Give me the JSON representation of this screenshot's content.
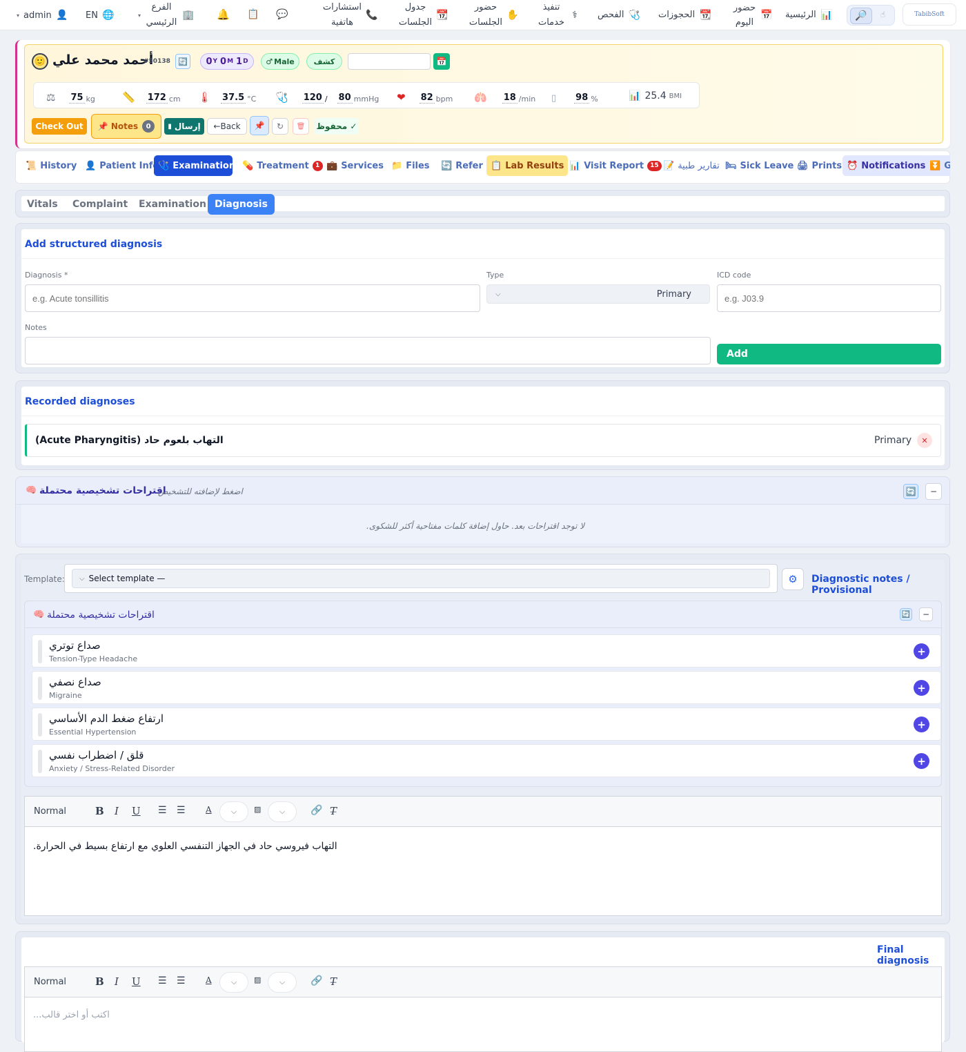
{
  "topbar": {
    "logo": "TabibSoft",
    "user": "admin",
    "lang": "EN",
    "nav": [
      {
        "label": "الرئيسية",
        "icon": "chart-icon"
      },
      {
        "label": "حضور اليوم",
        "icon": "calendar-icon"
      },
      {
        "label": "الحجوزات",
        "icon": "calendar-31-icon"
      },
      {
        "label": "الفحص",
        "icon": "stethoscope-icon"
      },
      {
        "label": "تنفيذ خدمات",
        "icon": "medical-icon"
      },
      {
        "label": "حضور الجلسات",
        "icon": "hand-icon"
      },
      {
        "label": "جدول الجلسات",
        "icon": "calendar-31-icon"
      },
      {
        "label": "استشارات هاتفية",
        "icon": "phone-icon"
      }
    ],
    "branch": "الفرع الرئيسي"
  },
  "patient": {
    "name": "أحمد محمد علي",
    "id": "#50138",
    "age": {
      "y": "0",
      "y_unit": "Y",
      "m": "0",
      "m_unit": "M",
      "d": "1",
      "d_unit": "D"
    },
    "gender": "Male",
    "visit_type": "كشف",
    "date_value": ""
  },
  "vitals": {
    "weight": "75",
    "weight_unit": "kg",
    "height": "172",
    "height_unit": "cm",
    "temp": "37.5",
    "temp_unit": "°C",
    "bp_sys": "120",
    "bp_sep": "/",
    "bp_dia": "80",
    "bp_unit": "mmHg",
    "pulse": "82",
    "pulse_unit": "bpm",
    "resp": "18",
    "resp_unit": "/min",
    "spo2": "98",
    "spo2_unit": "%",
    "bmi": "25.4",
    "bmi_unit": "BMI"
  },
  "actions": {
    "checkout": "Check Out",
    "notes": "Notes",
    "notes_count": "0",
    "send": "إرسال",
    "back": "←Back",
    "saved": "✓ محفوظ"
  },
  "tabs": [
    {
      "label": "History"
    },
    {
      "label": "Patient Info"
    },
    {
      "label": "Examination"
    },
    {
      "label": "Treatment",
      "badge": "1"
    },
    {
      "label": "Services"
    },
    {
      "label": "Files"
    },
    {
      "label": "Refer"
    },
    {
      "label": "Lab Results"
    },
    {
      "label": "Visit Report",
      "badge": "15"
    },
    {
      "label": "تقارير طبية"
    },
    {
      "label": "Sick Leave"
    },
    {
      "label": "Prints"
    },
    {
      "label": "Notifications"
    },
    {
      "label": "G"
    }
  ],
  "subtabs": [
    "Vitals",
    "Complaint",
    "Examination",
    "Diagnosis"
  ],
  "structured": {
    "title": "Add structured diagnosis",
    "diagnosis_label": "Diagnosis *",
    "diagnosis_placeholder": "e.g. Acute tonsillitis",
    "type_label": "Type",
    "type_value": "Primary",
    "icd_label": "ICD code",
    "icd_placeholder": "e.g. J03.9",
    "notes_label": "Notes",
    "add": "Add"
  },
  "recorded": {
    "title": "Recorded diagnoses",
    "items": [
      {
        "name": "التهاب بلعوم حاد (Acute Pharyngitis)",
        "type": "Primary"
      }
    ]
  },
  "suggest1": {
    "title": "اقتراحات تشخيصية محتملة",
    "hint": "اضغط لإضافته للتشخيص",
    "empty": ".لا توجد اقتراحات بعد. حاول إضافة كلمات مفتاحية أكثر للشكوى"
  },
  "provisional": {
    "template_label": "Template:",
    "template_value": "Select template —",
    "title": "Diagnostic notes / Provisional",
    "suggest_title": "اقتراحات تشخيصية محتملة",
    "suggestions": [
      {
        "ar": "صداع توتري",
        "en": "Tension-Type Headache"
      },
      {
        "ar": "صداع نصفي",
        "en": "Migraine"
      },
      {
        "ar": "ارتفاع ضغط الدم الأساسي",
        "en": "Essential Hypertension"
      },
      {
        "ar": "قلق / اضطراب نفسي",
        "en": "Anxiety / Stress-Related Disorder"
      }
    ],
    "editor_format": "Normal",
    "editor_text": "التهاب فيروسي حاد في الجهاز التنفسي العلوي مع ارتفاع بسيط في الحرارة."
  },
  "final": {
    "title": "Final diagnosis",
    "editor_format": "Normal",
    "placeholder": "اكتب أو اختر قالب..."
  }
}
